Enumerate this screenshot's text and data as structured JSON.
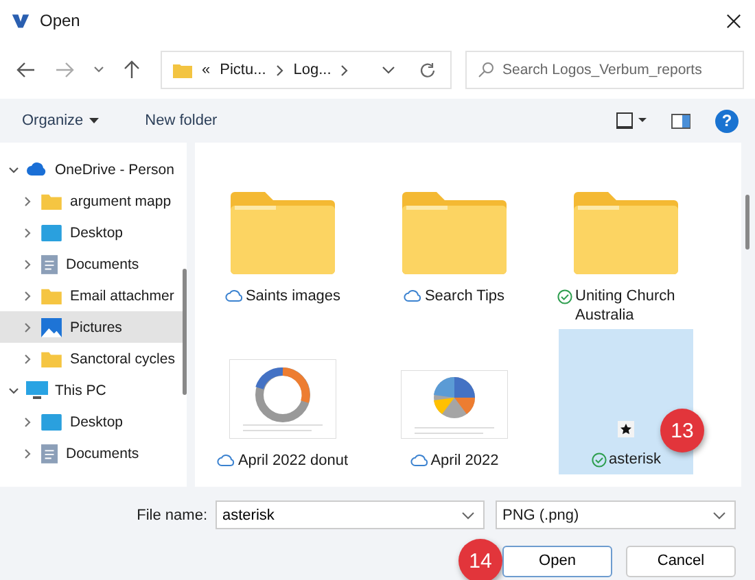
{
  "window": {
    "title": "Open"
  },
  "address": {
    "overflow": "«",
    "crumbs": [
      "Pictu...",
      "Log..."
    ]
  },
  "search": {
    "placeholder": "Search Logos_Verbum_reports"
  },
  "toolbar": {
    "organize": "Organize",
    "new_folder": "New folder",
    "help": "?"
  },
  "sidebar": {
    "items": [
      {
        "label": "OneDrive - Person",
        "kind": "cloud",
        "expanded": true,
        "selected": false,
        "children": [
          {
            "label": "argument mapp",
            "kind": "folder",
            "expanded": false,
            "selected": false
          },
          {
            "label": "Desktop",
            "kind": "desktop",
            "expanded": false,
            "selected": false
          },
          {
            "label": "Documents",
            "kind": "documents",
            "expanded": false,
            "selected": false
          },
          {
            "label": "Email attachmer",
            "kind": "folder",
            "expanded": false,
            "selected": false
          },
          {
            "label": "Pictures",
            "kind": "pictures",
            "expanded": false,
            "selected": true
          },
          {
            "label": "Sanctoral cycles",
            "kind": "folder",
            "expanded": false,
            "selected": false
          }
        ]
      },
      {
        "label": "This PC",
        "kind": "pc",
        "expanded": true,
        "selected": false,
        "children": [
          {
            "label": "Desktop",
            "kind": "desktop",
            "expanded": false,
            "selected": false
          },
          {
            "label": "Documents",
            "kind": "documents",
            "expanded": false,
            "selected": false
          }
        ]
      }
    ]
  },
  "files": [
    {
      "name": "Saints images",
      "kind": "folder",
      "synced": false,
      "selected": false
    },
    {
      "name": "Search Tips",
      "kind": "folder",
      "synced": false,
      "selected": false
    },
    {
      "name": "Uniting Church Australia",
      "kind": "folder",
      "synced": true,
      "selected": false
    },
    {
      "name": "April 2022 donut",
      "kind": "donut-image",
      "synced": false,
      "selected": false
    },
    {
      "name": "April 2022",
      "kind": "pie-image",
      "synced": false,
      "selected": false
    },
    {
      "name": "asterisk",
      "kind": "star-image",
      "synced": true,
      "selected": true,
      "step": "13"
    }
  ],
  "footer": {
    "file_name_label": "File name:",
    "file_name": "asterisk",
    "file_type": "PNG (.png)",
    "open": "Open",
    "cancel": "Cancel",
    "open_step": "14"
  }
}
